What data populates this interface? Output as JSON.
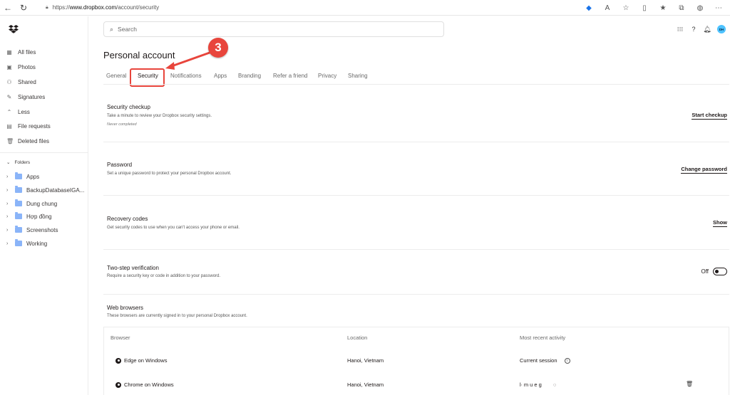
{
  "browser": {
    "url_prefix": "https://",
    "url_host": "www.dropbox.com",
    "url_path": "/account/security"
  },
  "sidebar": {
    "items": [
      {
        "label": "All files",
        "icon": "grid-icon"
      },
      {
        "label": "Photos",
        "icon": "photos-icon"
      },
      {
        "label": "Shared",
        "icon": "shared-icon"
      },
      {
        "label": "Signatures",
        "icon": "signature-icon"
      },
      {
        "label": "Less",
        "icon": "collapse-icon"
      },
      {
        "label": "File requests",
        "icon": "file-request-icon"
      },
      {
        "label": "Deleted files",
        "icon": "trash-icon"
      }
    ],
    "folders_label": "Folders",
    "folders": [
      "Apps",
      "BackupDatabaseIGA...",
      "Dung chung",
      "Hợp đồng",
      "Screenshots",
      "Working"
    ]
  },
  "search": {
    "placeholder": "Search"
  },
  "header": {
    "avatar_initials": "DH"
  },
  "page": {
    "title": "Personal account"
  },
  "tabs": [
    "General",
    "Security",
    "Notifications",
    "Apps",
    "Branding",
    "Refer a friend",
    "Privacy",
    "Sharing"
  ],
  "active_tab": "Security",
  "annotation": {
    "step": "3",
    "color": "#e8453c"
  },
  "sections": {
    "checkup": {
      "title": "Security checkup",
      "desc": "Take a minute to review your Dropbox security settings.",
      "note": "Never completed",
      "action": "Start checkup"
    },
    "password": {
      "title": "Password",
      "desc": "Set a unique password to protect your personal Dropbox account.",
      "action": "Change password"
    },
    "recovery": {
      "title": "Recovery codes",
      "desc": "Get security codes to use when you can't access your phone or email.",
      "action": "Show"
    },
    "twostep": {
      "title": "Two-step verification",
      "desc": "Require a security key or code in addition to your password.",
      "state": "Off"
    },
    "browsers": {
      "title": "Web browsers",
      "desc": "These browsers are currently signed in to your personal Dropbox account.",
      "columns": [
        "Browser",
        "Location",
        "Most recent activity"
      ],
      "rows": [
        {
          "browser": "Edge on Windows",
          "location": "Hanoi, Vietnam",
          "activity": "Current session"
        },
        {
          "browser": "Chrome on Windows",
          "location": "Hanoi, Vietnam",
          "activity": "l∙ m u e g"
        }
      ]
    }
  }
}
